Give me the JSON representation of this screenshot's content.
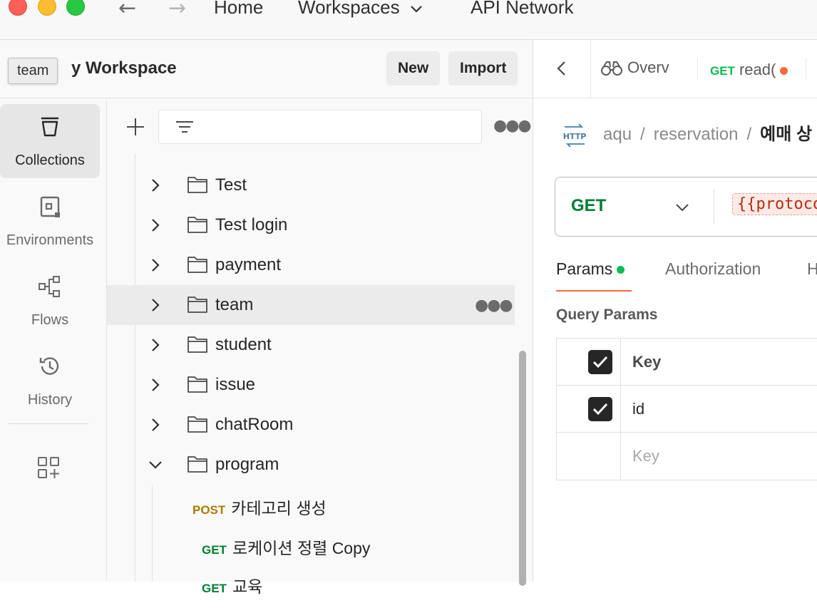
{
  "titlebar": {
    "nav_links": {
      "home": "Home",
      "workspaces": "Workspaces",
      "api_network": "API Network"
    }
  },
  "workspace": {
    "title": "y Workspace",
    "tooltip": "team",
    "new_label": "New",
    "import_label": "Import"
  },
  "sidebar": {
    "items": [
      {
        "label": "Collections",
        "icon": "collections-icon",
        "active": true
      },
      {
        "label": "Environments",
        "icon": "environments-icon"
      },
      {
        "label": "Flows",
        "icon": "flows-icon"
      },
      {
        "label": "History",
        "icon": "history-icon"
      }
    ]
  },
  "tree": {
    "folders": [
      {
        "name": "Test"
      },
      {
        "name": "Test login"
      },
      {
        "name": "payment"
      },
      {
        "name": "team",
        "hovered": true
      },
      {
        "name": "student"
      },
      {
        "name": "issue"
      },
      {
        "name": "chatRoom"
      },
      {
        "name": "program",
        "expanded": true
      }
    ],
    "requests": [
      {
        "method": "POST",
        "name": "카테고리 생성"
      },
      {
        "method": "GET",
        "name": "로케이션 정렬 Copy"
      },
      {
        "method": "GET",
        "name": "교육"
      }
    ]
  },
  "tabs": {
    "overview": "Overv",
    "request_method": "GET",
    "request_name": "read("
  },
  "breadcrumb": {
    "parts": [
      "aqu",
      "reservation"
    ],
    "current": "예매 상"
  },
  "request": {
    "method": "GET",
    "url_var": "{{protocol}"
  },
  "subtabs": {
    "params": "Params",
    "authorization": "Authorization",
    "headers": "H"
  },
  "query_params": {
    "title": "Query Params",
    "header_key": "Key",
    "rows": [
      {
        "key": "id",
        "checked": true
      }
    ],
    "placeholder_key": "Key"
  }
}
